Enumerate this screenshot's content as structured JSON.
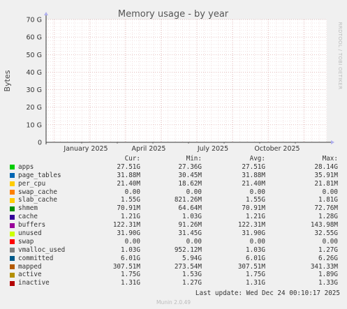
{
  "chart_data": {
    "type": "area",
    "title": "Memory usage - by year",
    "ylabel": "Bytes",
    "side_text": "RRDTOOL / TOBI OETIKER",
    "ylim": [
      0,
      70000000000
    ],
    "yticks": [
      {
        "value": 0,
        "label": "0"
      },
      {
        "value": 10000000000,
        "label": "10 G"
      },
      {
        "value": 20000000000,
        "label": "20 G"
      },
      {
        "value": 30000000000,
        "label": "30 G"
      },
      {
        "value": 40000000000,
        "label": "40 G"
      },
      {
        "value": 50000000000,
        "label": "50 G"
      },
      {
        "value": 60000000000,
        "label": "60 G"
      },
      {
        "value": 70000000000,
        "label": "70 G"
      }
    ],
    "xticks": [
      "January 2025",
      "April 2025",
      "July 2025",
      "October 2025"
    ],
    "grid": true,
    "series": []
  },
  "legend": {
    "headers": {
      "cur": "Cur:",
      "min": "Min:",
      "avg": "Avg:",
      "max": "Max:"
    },
    "rows": [
      {
        "name": "apps",
        "color": "#00cc00",
        "cur": "27.51G",
        "min": "27.36G",
        "avg": "27.51G",
        "max": "28.14G"
      },
      {
        "name": "page_tables",
        "color": "#0066b3",
        "cur": "31.88M",
        "min": "30.45M",
        "avg": "31.88M",
        "max": "35.91M"
      },
      {
        "name": "per_cpu",
        "color": "#ffcc00",
        "cur": "21.40M",
        "min": "18.62M",
        "avg": "21.40M",
        "max": "21.81M"
      },
      {
        "name": "swap_cache",
        "color": "#ff8000",
        "cur": "0.00",
        "min": "0.00",
        "avg": "0.00",
        "max": "0.00"
      },
      {
        "name": "slab_cache",
        "color": "#ffcc00",
        "cur": "1.55G",
        "min": "821.26M",
        "avg": "1.55G",
        "max": "1.81G"
      },
      {
        "name": "shmem",
        "color": "#008f00",
        "cur": "70.91M",
        "min": "64.64M",
        "avg": "70.91M",
        "max": "72.76M"
      },
      {
        "name": "cache",
        "color": "#330099",
        "cur": "1.21G",
        "min": "1.03G",
        "avg": "1.21G",
        "max": "1.28G"
      },
      {
        "name": "buffers",
        "color": "#990099",
        "cur": "122.31M",
        "min": "91.26M",
        "avg": "122.31M",
        "max": "143.98M"
      },
      {
        "name": "unused",
        "color": "#ccff00",
        "cur": "31.90G",
        "min": "31.45G",
        "avg": "31.90G",
        "max": "32.55G"
      },
      {
        "name": "swap",
        "color": "#ff0000",
        "cur": "0.00",
        "min": "0.00",
        "avg": "0.00",
        "max": "0.00"
      },
      {
        "name": "vmalloc_used",
        "color": "#808080",
        "cur": "1.03G",
        "min": "952.12M",
        "avg": "1.03G",
        "max": "1.27G"
      },
      {
        "name": "committed",
        "color": "#005a8a",
        "cur": "6.01G",
        "min": "5.94G",
        "avg": "6.01G",
        "max": "6.26G"
      },
      {
        "name": "mapped",
        "color": "#b35a00",
        "cur": "307.51M",
        "min": "273.54M",
        "avg": "307.51M",
        "max": "341.33M"
      },
      {
        "name": "active",
        "color": "#b38f00",
        "cur": "1.75G",
        "min": "1.53G",
        "avg": "1.75G",
        "max": "1.89G"
      },
      {
        "name": "inactive",
        "color": "#b30000",
        "cur": "1.31G",
        "min": "1.27G",
        "avg": "1.31G",
        "max": "1.33G"
      }
    ]
  },
  "last_update": "Last update: Wed Dec 24 00:10:17 2025",
  "footer": "Munin 2.0.49"
}
